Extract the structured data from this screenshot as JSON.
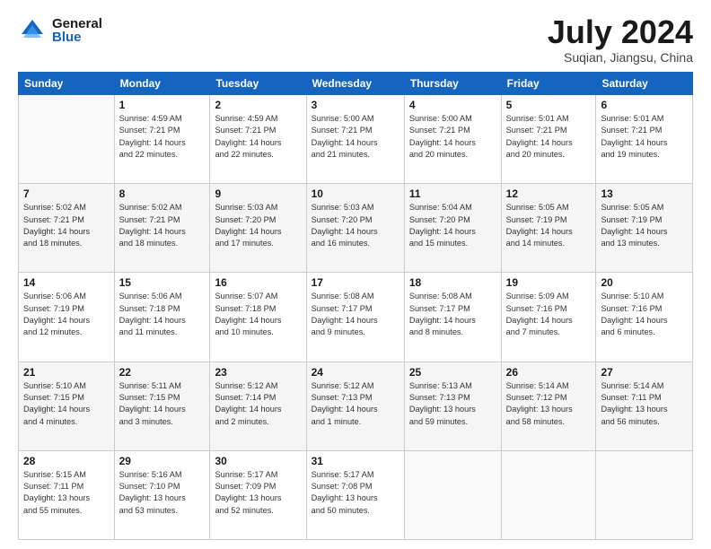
{
  "header": {
    "logo_general": "General",
    "logo_blue": "Blue",
    "title": "July 2024",
    "location": "Suqian, Jiangsu, China"
  },
  "days_of_week": [
    "Sunday",
    "Monday",
    "Tuesday",
    "Wednesday",
    "Thursday",
    "Friday",
    "Saturday"
  ],
  "weeks": [
    [
      {
        "day": "",
        "info": ""
      },
      {
        "day": "1",
        "info": "Sunrise: 4:59 AM\nSunset: 7:21 PM\nDaylight: 14 hours\nand 22 minutes."
      },
      {
        "day": "2",
        "info": "Sunrise: 4:59 AM\nSunset: 7:21 PM\nDaylight: 14 hours\nand 22 minutes."
      },
      {
        "day": "3",
        "info": "Sunrise: 5:00 AM\nSunset: 7:21 PM\nDaylight: 14 hours\nand 21 minutes."
      },
      {
        "day": "4",
        "info": "Sunrise: 5:00 AM\nSunset: 7:21 PM\nDaylight: 14 hours\nand 20 minutes."
      },
      {
        "day": "5",
        "info": "Sunrise: 5:01 AM\nSunset: 7:21 PM\nDaylight: 14 hours\nand 20 minutes."
      },
      {
        "day": "6",
        "info": "Sunrise: 5:01 AM\nSunset: 7:21 PM\nDaylight: 14 hours\nand 19 minutes."
      }
    ],
    [
      {
        "day": "7",
        "info": "Sunrise: 5:02 AM\nSunset: 7:21 PM\nDaylight: 14 hours\nand 18 minutes."
      },
      {
        "day": "8",
        "info": "Sunrise: 5:02 AM\nSunset: 7:21 PM\nDaylight: 14 hours\nand 18 minutes."
      },
      {
        "day": "9",
        "info": "Sunrise: 5:03 AM\nSunset: 7:20 PM\nDaylight: 14 hours\nand 17 minutes."
      },
      {
        "day": "10",
        "info": "Sunrise: 5:03 AM\nSunset: 7:20 PM\nDaylight: 14 hours\nand 16 minutes."
      },
      {
        "day": "11",
        "info": "Sunrise: 5:04 AM\nSunset: 7:20 PM\nDaylight: 14 hours\nand 15 minutes."
      },
      {
        "day": "12",
        "info": "Sunrise: 5:05 AM\nSunset: 7:19 PM\nDaylight: 14 hours\nand 14 minutes."
      },
      {
        "day": "13",
        "info": "Sunrise: 5:05 AM\nSunset: 7:19 PM\nDaylight: 14 hours\nand 13 minutes."
      }
    ],
    [
      {
        "day": "14",
        "info": "Sunrise: 5:06 AM\nSunset: 7:19 PM\nDaylight: 14 hours\nand 12 minutes."
      },
      {
        "day": "15",
        "info": "Sunrise: 5:06 AM\nSunset: 7:18 PM\nDaylight: 14 hours\nand 11 minutes."
      },
      {
        "day": "16",
        "info": "Sunrise: 5:07 AM\nSunset: 7:18 PM\nDaylight: 14 hours\nand 10 minutes."
      },
      {
        "day": "17",
        "info": "Sunrise: 5:08 AM\nSunset: 7:17 PM\nDaylight: 14 hours\nand 9 minutes."
      },
      {
        "day": "18",
        "info": "Sunrise: 5:08 AM\nSunset: 7:17 PM\nDaylight: 14 hours\nand 8 minutes."
      },
      {
        "day": "19",
        "info": "Sunrise: 5:09 AM\nSunset: 7:16 PM\nDaylight: 14 hours\nand 7 minutes."
      },
      {
        "day": "20",
        "info": "Sunrise: 5:10 AM\nSunset: 7:16 PM\nDaylight: 14 hours\nand 6 minutes."
      }
    ],
    [
      {
        "day": "21",
        "info": "Sunrise: 5:10 AM\nSunset: 7:15 PM\nDaylight: 14 hours\nand 4 minutes."
      },
      {
        "day": "22",
        "info": "Sunrise: 5:11 AM\nSunset: 7:15 PM\nDaylight: 14 hours\nand 3 minutes."
      },
      {
        "day": "23",
        "info": "Sunrise: 5:12 AM\nSunset: 7:14 PM\nDaylight: 14 hours\nand 2 minutes."
      },
      {
        "day": "24",
        "info": "Sunrise: 5:12 AM\nSunset: 7:13 PM\nDaylight: 14 hours\nand 1 minute."
      },
      {
        "day": "25",
        "info": "Sunrise: 5:13 AM\nSunset: 7:13 PM\nDaylight: 13 hours\nand 59 minutes."
      },
      {
        "day": "26",
        "info": "Sunrise: 5:14 AM\nSunset: 7:12 PM\nDaylight: 13 hours\nand 58 minutes."
      },
      {
        "day": "27",
        "info": "Sunrise: 5:14 AM\nSunset: 7:11 PM\nDaylight: 13 hours\nand 56 minutes."
      }
    ],
    [
      {
        "day": "28",
        "info": "Sunrise: 5:15 AM\nSunset: 7:11 PM\nDaylight: 13 hours\nand 55 minutes."
      },
      {
        "day": "29",
        "info": "Sunrise: 5:16 AM\nSunset: 7:10 PM\nDaylight: 13 hours\nand 53 minutes."
      },
      {
        "day": "30",
        "info": "Sunrise: 5:17 AM\nSunset: 7:09 PM\nDaylight: 13 hours\nand 52 minutes."
      },
      {
        "day": "31",
        "info": "Sunrise: 5:17 AM\nSunset: 7:08 PM\nDaylight: 13 hours\nand 50 minutes."
      },
      {
        "day": "",
        "info": ""
      },
      {
        "day": "",
        "info": ""
      },
      {
        "day": "",
        "info": ""
      }
    ]
  ]
}
